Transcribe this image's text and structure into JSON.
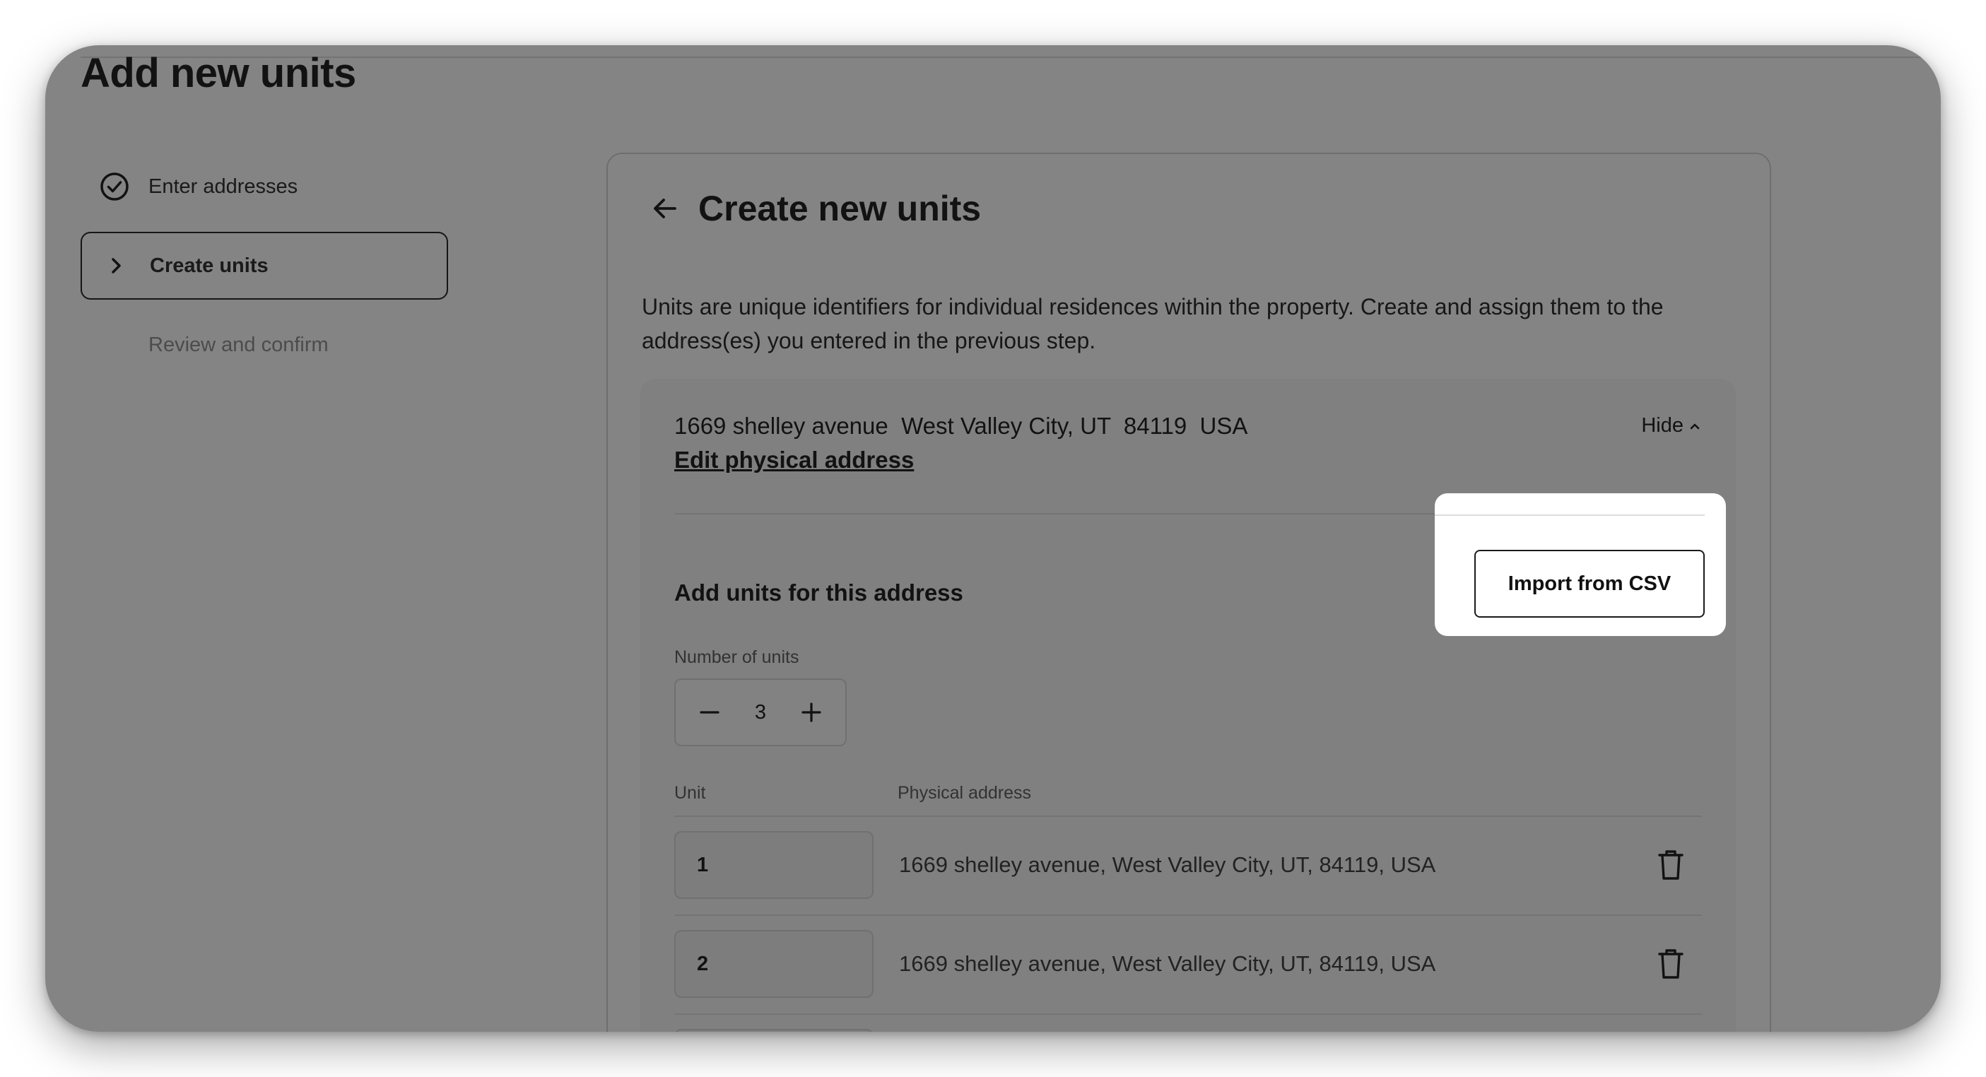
{
  "page": {
    "title": "Add new units"
  },
  "steps": [
    {
      "label": "Enter addresses",
      "state": "done",
      "icon": "check-circle-icon"
    },
    {
      "label": "Create units",
      "state": "current",
      "icon": "chevron-right-icon"
    },
    {
      "label": "Review and confirm",
      "state": "upcoming"
    }
  ],
  "card": {
    "title": "Create new units",
    "description": "Units are unique identifiers for individual residences within the property. Create and assign them to the address(es) you entered in the previous step.",
    "address": {
      "line": "1669 shelley avenue  West Valley City, UT  84119  USA",
      "edit_label": "Edit physical address",
      "toggle_label": "Hide"
    },
    "section_title": "Add units for this address",
    "import_label": "Import from CSV",
    "number_label": "Number of units",
    "number_value": "3",
    "columns": {
      "unit": "Unit",
      "address": "Physical address"
    },
    "rows": [
      {
        "unit": "1",
        "address": "1669 shelley avenue, West Valley City, UT, 84119, USA"
      },
      {
        "unit": "2",
        "address": "1669 shelley avenue, West Valley City, UT, 84119, USA"
      },
      {
        "unit": "",
        "address": ""
      }
    ]
  },
  "colors": {
    "overlay": "#141414",
    "text": "#111111",
    "panel": "#f7f7f7"
  }
}
